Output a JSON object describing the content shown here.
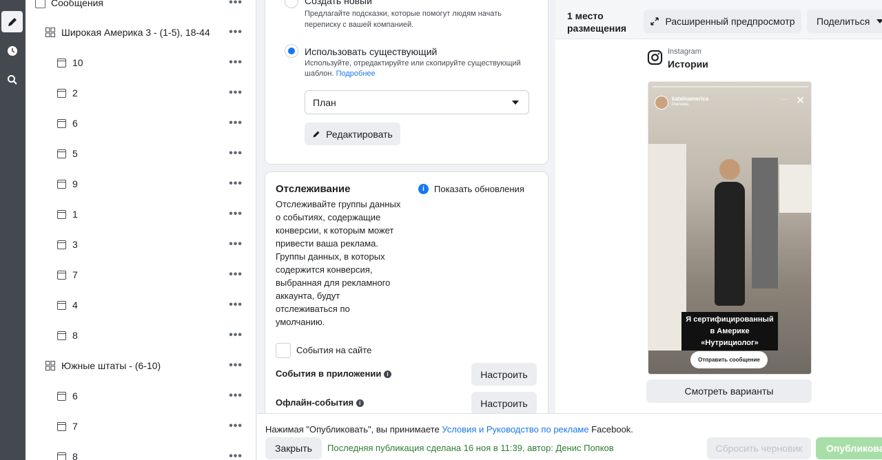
{
  "tree": {
    "top_item": "Сообщения",
    "groups": [
      {
        "label": "Широкая Америка 3 - (1-5), 18-44",
        "ads": [
          "10",
          "2",
          "6",
          "5",
          "9",
          "1",
          "3",
          "7",
          "4",
          "8"
        ]
      },
      {
        "label": "Южные штаты - (6-10)",
        "ads": [
          "6",
          "7",
          "8"
        ]
      }
    ],
    "more_glyph": "•••"
  },
  "template_card": {
    "create_new_label": "Создать новый",
    "create_new_desc_1": "Предлагайте подсказки, которые помогут людям начать",
    "create_new_desc_2": "переписку с вашей компанией.",
    "use_existing_label": "Использовать существующий",
    "use_existing_desc_1": "Используйте, отредактируйте или скопируйте существующий",
    "use_existing_desc_2": "шаблон.",
    "learn_more": "Подробнее",
    "select_value": "План",
    "edit_button": "Редактировать"
  },
  "tracking_card": {
    "title": "Отслеживание",
    "show_updates": "Показать обновления",
    "desc_lines": [
      "Отслеживайте группы данных",
      "о событиях, содержащие",
      "конверсии, к которым может",
      "привести ваша реклама.",
      "Группы данных, в которых",
      "содержится конверсия,",
      "выбранная для рекламного",
      "аккаунта, будут",
      "отслеживаться по",
      "умолчанию."
    ],
    "website_events": "События на сайте",
    "app_events": "События в приложении",
    "offline_events": "Офлайн-события",
    "configure": "Настроить"
  },
  "preview": {
    "placements_line1": "1 место",
    "placements_line2": "размещения",
    "advanced_preview": "Расширенный предпросмотр",
    "share": "Поделиться",
    "platform": "Instagram",
    "placement": "Истории",
    "account_name": "kateinamerica",
    "sponsored": "Реклама",
    "caption_line1": "Я сертифицированный",
    "caption_line2": "в Америке",
    "caption_line3": "«Нутрициолог»",
    "cta": "Отправить сообщение",
    "view_variants": "Смотреть варианты"
  },
  "bottom_bar": {
    "terms_prefix": "Нажимая \"Опубликовать\", вы принимаете ",
    "terms_link": "Условия и Руководство по рекламе",
    "terms_suffix": " Facebook.",
    "close": "Закрыть",
    "last_published": "Последняя публикация сделана 16 ноя в 11:39, автор: Денис Попков",
    "reset_draft": "Сбросить черновик",
    "publish": "Опубликовать"
  },
  "colors": {
    "accent": "#1877f2",
    "success_text": "#2e7d32",
    "publish_disabled": "#a8dfa8",
    "rail": "#444950"
  }
}
